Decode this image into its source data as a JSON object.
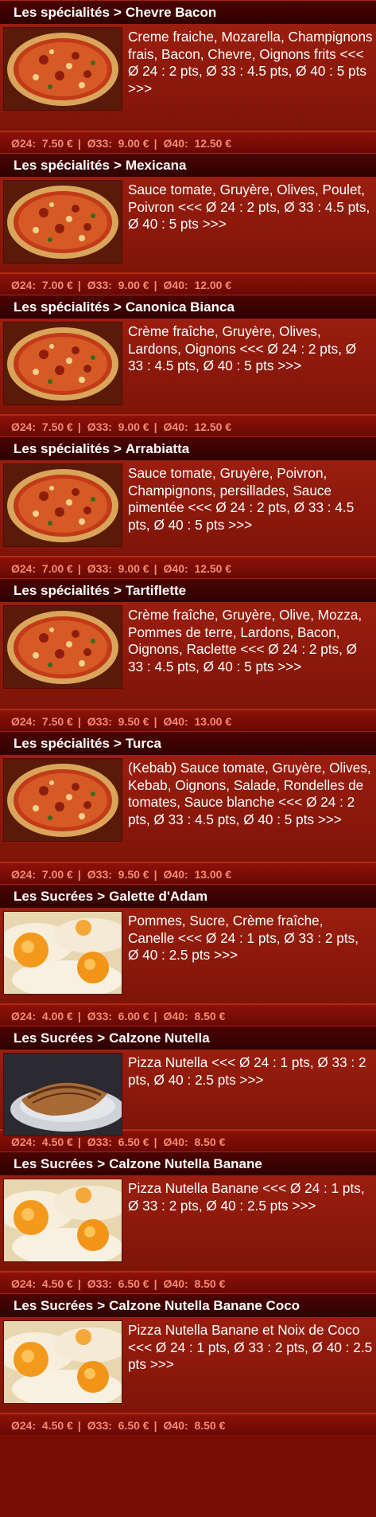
{
  "items": [
    {
      "category": "Les spécialités",
      "name": "Chevre Bacon",
      "image": "pizza",
      "description": "Creme fraiche, Mozarella, Champignons frais, Bacon, Chevre, Oignons frits <<< Ø 24 : 2 pts, Ø 33 : 4.5 pts, Ø 40 : 5 pts >>>",
      "prices": [
        "7.50 €",
        "9.00 €",
        "12.50 €"
      ]
    },
    {
      "category": "Les spécialités",
      "name": "Mexicana",
      "image": "pizza",
      "description": "Sauce tomate, Gruyère, Olives, Poulet, Poivron <<< Ø 24 : 2 pts, Ø 33 : 4.5 pts, Ø 40 : 5 pts >>>",
      "prices": [
        "7.00 €",
        "9.00 €",
        "12.00 €"
      ]
    },
    {
      "category": "Les spécialités",
      "name": "Canonica Bianca",
      "image": "pizza",
      "description": "Crème fraîche, Gruyère, Olives, Lardons, Oignons <<< Ø 24 : 2 pts, Ø 33 : 4.5 pts, Ø 40 : 5 pts >>>",
      "prices": [
        "7.50 €",
        "9.00 €",
        "12.50 €"
      ]
    },
    {
      "category": "Les spécialités",
      "name": "Arrabiatta",
      "image": "pizza",
      "description": "Sauce tomate, Gruyère, Poivron, Champignons, persillades, Sauce pimentée <<< Ø 24 : 2 pts, Ø 33 : 4.5 pts, Ø 40 : 5 pts >>>",
      "prices": [
        "7.00 €",
        "9.00 €",
        "12.50 €"
      ]
    },
    {
      "category": "Les spécialités",
      "name": "Tartiflette",
      "image": "pizza",
      "description": "Crème fraîche, Gruyère, Olive, Mozza, Pommes de terre, Lardons, Bacon, Oignons, Raclette <<< Ø 24 : 2 pts, Ø 33 : 4.5 pts, Ø 40 : 5 pts >>>",
      "prices": [
        "7.50 €",
        "9.50 €",
        "13.00 €"
      ]
    },
    {
      "category": "Les spécialités",
      "name": "Turca",
      "image": "pizza",
      "description": "(Kebab) Sauce tomate, Gruyère, Olives, Kebab, Oignons, Salade, Rondelles de tomates, Sauce blanche <<< Ø 24 : 2 pts, Ø 33 : 4.5 pts, Ø 40 : 5 pts >>>",
      "prices": [
        "7.00 €",
        "9.50 €",
        "13.00 €"
      ]
    },
    {
      "category": "Les Sucrées",
      "name": "Galette d'Adam",
      "image": "egg",
      "description": "Pommes, Sucre, Crème fraîche, Canelle <<< Ø 24 : 1 pts, Ø 33 : 2 pts, Ø 40 : 2.5 pts >>>",
      "prices": [
        "4.00 €",
        "6.00 €",
        "8.50 €"
      ]
    },
    {
      "category": "Les Sucrées",
      "name": "Calzone Nutella",
      "image": "calzone",
      "description": "Pizza Nutella <<< Ø 24 : 1 pts, Ø 33 : 2 pts, Ø 40 : 2.5 pts >>>",
      "prices": [
        "4.50 €",
        "6.50 €",
        "8.50 €"
      ]
    },
    {
      "category": "Les Sucrées",
      "name": "Calzone Nutella Banane",
      "image": "egg",
      "description": "Pizza Nutella Banane <<< Ø 24 : 1 pts, Ø 33 : 2 pts, Ø 40 : 2.5 pts >>>",
      "prices": [
        "4.50 €",
        "6.50 €",
        "8.50 €"
      ]
    },
    {
      "category": "Les Sucrées",
      "name": "Calzone Nutella Banane Coco",
      "image": "egg",
      "description": "Pizza Nutella Banane et Noix de Coco <<< Ø 24 : 1 pts, Ø 33 : 2 pts, Ø 40 : 2.5 pts >>>",
      "prices": [
        "4.50 €",
        "6.50 €",
        "8.50 €"
      ]
    }
  ],
  "size_labels": [
    "Ø24:",
    "Ø33:",
    "Ø40:"
  ],
  "separator": "|",
  "title_separator": ">",
  "colors": {
    "price_text": "#f38a72",
    "header_bg": "#3a0201",
    "body_bg": "#8e1a0c"
  }
}
